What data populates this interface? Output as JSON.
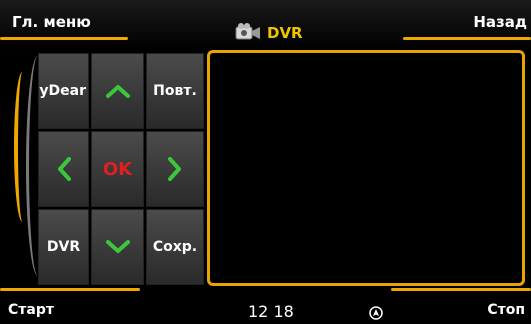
{
  "topbar": {
    "menu_label": "Гл. меню",
    "title": "DVR",
    "back_label": "Назад"
  },
  "controls": {
    "mydear_label": "MyDear",
    "repeat_label": "Повт.",
    "ok_label": "OK",
    "dvr_label": "DVR",
    "save_label": "Сохр."
  },
  "bottombar": {
    "start_label": "Старт",
    "clock": "12 18",
    "stop_label": "Стоп"
  },
  "colors": {
    "accent": "#f0a800",
    "title": "#f0c400",
    "arrow": "#3cc63c",
    "ok": "#e02020"
  },
  "icons": {
    "title": "video-camera-icon",
    "status": "navigation-arrow-icon"
  }
}
